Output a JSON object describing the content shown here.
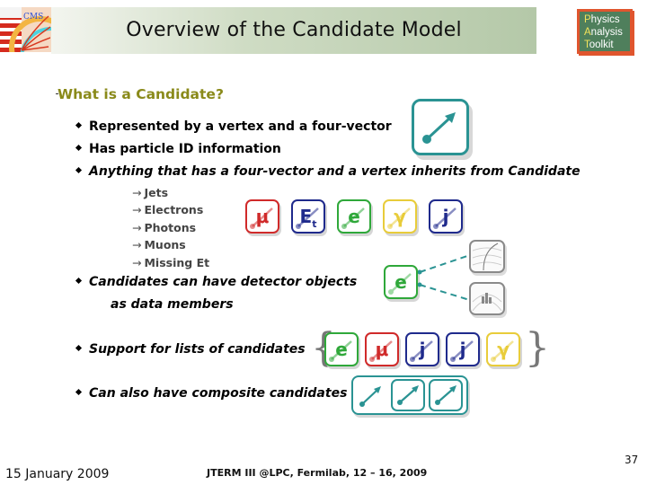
{
  "header": {
    "title": "Overview of the Candidate Model",
    "logo_text": "CMS",
    "badge": {
      "lines": [
        {
          "initial": "P",
          "rest": "hysics"
        },
        {
          "initial": "A",
          "rest": "nalysis"
        },
        {
          "initial": "T",
          "rest": "oolkit"
        }
      ]
    }
  },
  "section": {
    "title": "What is a Candidate?"
  },
  "bullets": [
    {
      "text": "Represented by a vertex and a four-vector"
    },
    {
      "text": "Has particle ID information"
    },
    {
      "text": "Anything that has a four-vector and a vertex inherits from Candidate"
    },
    {
      "text": "Candidates can have detector objects",
      "continuation": "as data members"
    },
    {
      "text": "Support for lists of candidates"
    },
    {
      "text": "Can also have composite candidates"
    }
  ],
  "sub_items": [
    {
      "arrow": "→",
      "text": "Jets"
    },
    {
      "arrow": "→",
      "text": "Electrons"
    },
    {
      "arrow": "→",
      "text": "Photons"
    },
    {
      "arrow": "→",
      "text": "Muons"
    },
    {
      "arrow": "→",
      "text": "Missing Et"
    }
  ],
  "particle_icons": [
    {
      "symbol": "μ",
      "name": "muon",
      "color": "#d02a2a"
    },
    {
      "symbol": "E",
      "subscript": "t",
      "name": "missing-et",
      "color": "#1f2a8c"
    },
    {
      "symbol": "e",
      "name": "electron",
      "color": "#2fa83a"
    },
    {
      "symbol": "γ",
      "name": "photon",
      "color": "#e8cc3a"
    },
    {
      "symbol": "j",
      "name": "jet",
      "color": "#1f2a8c"
    }
  ],
  "list_icons": [
    {
      "symbol": "e",
      "name": "electron",
      "color": "#2fa83a"
    },
    {
      "symbol": "μ",
      "name": "muon",
      "color": "#d02a2a"
    },
    {
      "symbol": "j",
      "name": "jet",
      "color": "#1f2a8c"
    },
    {
      "symbol": "j",
      "name": "jet",
      "color": "#1f2a8c"
    },
    {
      "symbol": "γ",
      "name": "photon",
      "color": "#e8cc3a"
    }
  ],
  "detector_example": {
    "symbol": "e",
    "color": "#2fa83a",
    "arrow_color": "#2a9393"
  },
  "colors": {
    "teal": "#2a9393",
    "section_title": "#8a8a1a",
    "badge_bg": "#4f7f5c",
    "badge_border": "#e0552e",
    "badge_highlight": "#f1e35a"
  },
  "footer": {
    "date": "15 January 2009",
    "event": "JTERM III @LPC, Fermilab, 12 – 16, 2009",
    "page": "37"
  }
}
